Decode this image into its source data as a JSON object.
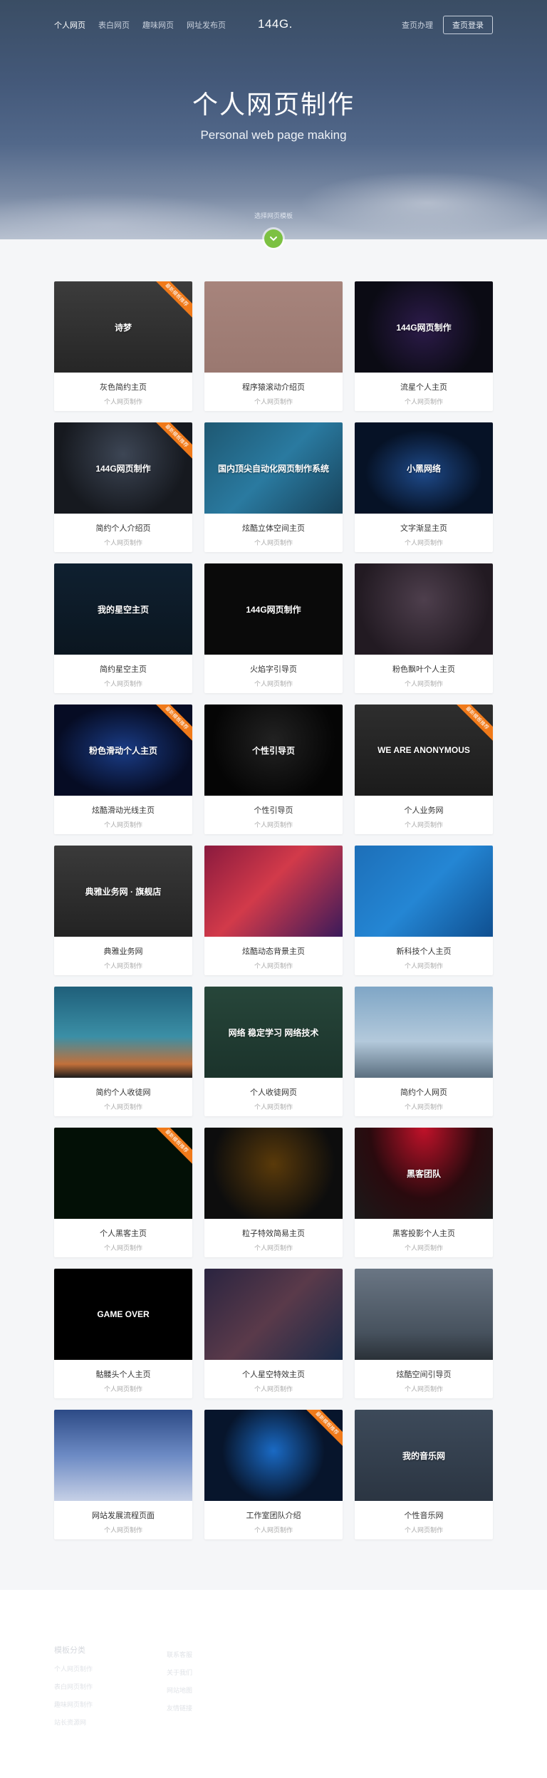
{
  "nav": {
    "links": [
      "个人网页",
      "表白网页",
      "趣味网页",
      "网址发布页"
    ],
    "brand": "144G.",
    "help": "查页办理",
    "login": "查页登录"
  },
  "hero": {
    "title": "个人网页制作",
    "subtitle": "Personal web page making",
    "hint": "选择网页模板"
  },
  "colors": {
    "accent": "#7cc142",
    "ribbon": "#f07a1a"
  },
  "cards": [
    {
      "title": "灰色简约主页",
      "sub": "个人网页制作",
      "thumb_text": "诗梦",
      "bg": "linear-gradient(180deg,#3c3c3c,#262626)",
      "ribbon": "最新模板推荐"
    },
    {
      "title": "程序猿滚动介绍页",
      "sub": "个人网页制作",
      "thumb_text": "",
      "bg": "linear-gradient(180deg,#a7847c,#9a7870)"
    },
    {
      "title": "流星个人主页",
      "sub": "个人网页制作",
      "thumb_text": "144G网页制作",
      "bg": "radial-gradient(circle at 50% 50%,#2c1b4a,#0b0b14 70%)"
    },
    {
      "title": "简约个人介绍页",
      "sub": "个人网页制作",
      "thumb_text": "144G网页制作",
      "bg": "radial-gradient(circle at 50% 35%,#3d4655,#16191f 70%)",
      "ribbon": "最新模板推荐"
    },
    {
      "title": "炫酷立体空间主页",
      "sub": "个人网页制作",
      "thumb_text": "国内顶尖自动化网页制作系统",
      "bg": "linear-gradient(135deg,#1e5872,#2a7aa0 50%,#17425a)"
    },
    {
      "title": "文字渐显主页",
      "sub": "个人网页制作",
      "thumb_text": "小黑网络",
      "bg": "radial-gradient(ellipse at 50% 55%,#1e4a8a,#061226 60%)"
    },
    {
      "title": "简约星空主页",
      "sub": "个人网页制作",
      "thumb_text": "我的星空主页",
      "bg": "linear-gradient(180deg,#0f2030,#0b1620)"
    },
    {
      "title": "火焰字引导页",
      "sub": "个人网页制作",
      "thumb_text": "144G网页制作",
      "bg": "#0a0a0a"
    },
    {
      "title": "粉色飘叶个人主页",
      "sub": "个人网页制作",
      "thumb_text": "",
      "bg": "radial-gradient(circle at 50% 40%,#4e3f4d,#221a22 75%)"
    },
    {
      "title": "炫酷滑动光线主页",
      "sub": "个人网页制作",
      "thumb_text": "粉色滑动个人主页",
      "bg": "radial-gradient(ellipse at 50% 50%,#1a3c86,#060c24 70%)",
      "ribbon": "最新模板推荐"
    },
    {
      "title": "个性引导页",
      "sub": "个人网页制作",
      "thumb_text": "个性引导页",
      "bg": "radial-gradient(circle at 50% 40%,#222,#050505 70%)"
    },
    {
      "title": "个人业务网",
      "sub": "个人网页制作",
      "thumb_text": "WE ARE ANONYMOUS",
      "bg": "linear-gradient(180deg,#2e2e2e,#1b1b1b)",
      "ribbon": "最新模板推荐"
    },
    {
      "title": "典雅业务网",
      "sub": "个人网页制作",
      "thumb_text": "典雅业务网 · 旗舰店",
      "bg": "linear-gradient(180deg,#3a3a3a,#232323)"
    },
    {
      "title": "炫酷动态背景主页",
      "sub": "个人网页制作",
      "thumb_text": "",
      "bg": "linear-gradient(135deg,#8a1a3e,#d23a4a 45%,#3a1a5a)"
    },
    {
      "title": "新科技个人主页",
      "sub": "个人网页制作",
      "thumb_text": "",
      "bg": "linear-gradient(135deg,#1d6fb8,#2486d4 50%,#0f4f90)"
    },
    {
      "title": "简约个人收徒网",
      "sub": "个人网页制作",
      "thumb_text": "",
      "bg": "linear-gradient(180deg,#1f5f7a,#3b8fa6 55%,#c2703a 85%,#1b1b1b)"
    },
    {
      "title": "个人收徒网页",
      "sub": "个人网页制作",
      "thumb_text": "网络 稳定学习 网络技术",
      "bg": "linear-gradient(180deg,#27463a,#1b332b)"
    },
    {
      "title": "简约个人网页",
      "sub": "个人网页制作",
      "thumb_text": "",
      "bg": "linear-gradient(180deg,#7fa6c6,#b3c9db 60%,#5b6f80)"
    },
    {
      "title": "个人黑客主页",
      "sub": "个人网页制作",
      "thumb_text": "",
      "bg": "#031006",
      "ribbon": "最新模板推荐"
    },
    {
      "title": "粒子特效简易主页",
      "sub": "个人网页制作",
      "thumb_text": "",
      "bg": "radial-gradient(circle at 50% 40%,#5a3a0a,#0d0d0d 70%)"
    },
    {
      "title": "黑客投影个人主页",
      "sub": "个人网页制作",
      "thumb_text": "黑客团队",
      "bg": "radial-gradient(ellipse at 50% 0%,#c2122a,#2a0a0e 55%,#1a1a1a)"
    },
    {
      "title": "骷髅头个人主页",
      "sub": "个人网页制作",
      "thumb_text": "GAME OVER",
      "bg": "#000"
    },
    {
      "title": "个人星空特效主页",
      "sub": "个人网页制作",
      "thumb_text": "",
      "bg": "linear-gradient(135deg,#2a2440,#5a3a4a 50%,#1a2a48)"
    },
    {
      "title": "炫酷空间引导页",
      "sub": "个人网页制作",
      "thumb_text": "",
      "bg": "linear-gradient(180deg,#6a7684,#47525e 70%,#2a3138)"
    },
    {
      "title": "网站发展流程页面",
      "sub": "个人网页制作",
      "thumb_text": "",
      "bg": "linear-gradient(180deg,#2c4a86,#6c8ac4 50%,#c6d0e6)"
    },
    {
      "title": "工作室团队介绍",
      "sub": "个人网页制作",
      "thumb_text": "",
      "bg": "radial-gradient(circle at 50% 45%,#1a6ac4,#07152c 60%)",
      "ribbon": "最新模板推荐"
    },
    {
      "title": "个性音乐网",
      "sub": "个人网页制作",
      "thumb_text": "我的音乐网",
      "bg": "linear-gradient(180deg,#3d4a5a,#2b3542)"
    }
  ],
  "footer": {
    "heading": "模板分类",
    "col1": [
      "个人网页制作",
      "表白网页制作",
      "趣味网页制作",
      "站长资源网"
    ],
    "col2": [
      "联系客服",
      "关于我们",
      "网站地图",
      "友情链接"
    ]
  }
}
